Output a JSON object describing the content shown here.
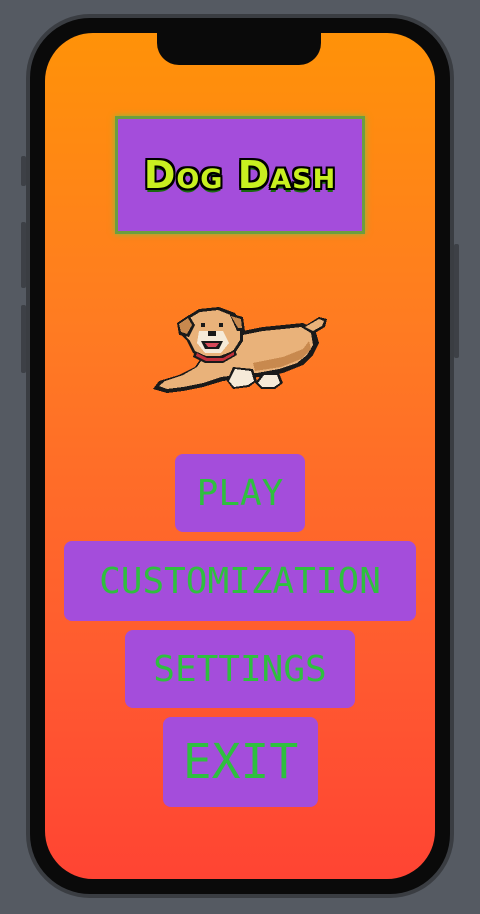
{
  "app": {
    "title": "Dog Dash"
  },
  "menu": {
    "play_label": "PLAY",
    "customization_label": "CUSTOMIZATION",
    "settings_label": "SETTINGS",
    "exit_label": "EXIT"
  },
  "colors": {
    "background_top": "#ff9208",
    "background_bottom": "#ff4433",
    "button_fill": "#a44ddb",
    "button_text": "#2fbf3f",
    "title_text": "#c8f020"
  },
  "mascot": {
    "icon": "dog-icon"
  }
}
